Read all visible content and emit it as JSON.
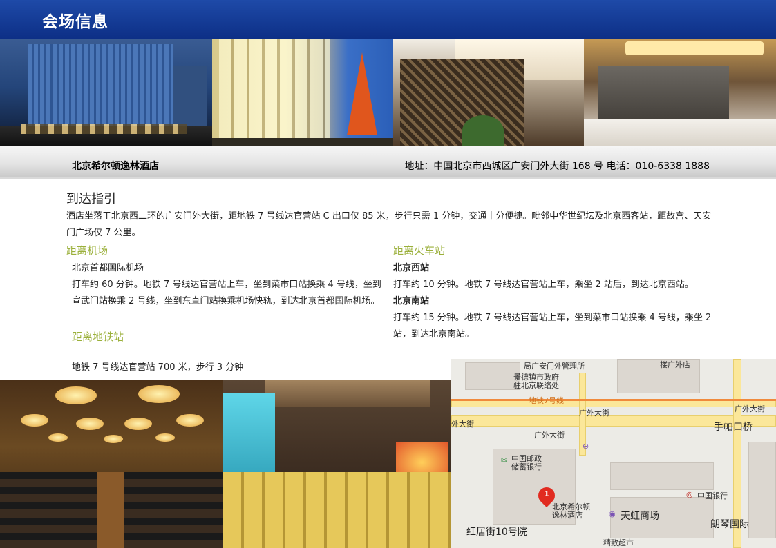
{
  "header": {
    "title": "会场信息"
  },
  "hotel": {
    "name": "北京希尔顿逸林酒店",
    "address_line": "地址：中国北京市西城区广安门外大街 168 号   电话：010-6338 1888"
  },
  "directions": {
    "title": "到达指引",
    "intro": "酒店坐落于北京西二环的广安门外大街，距地铁 7 号线达官营站 C 出口仅 85 米，步行只需 1 分钟，交通十分便捷。毗邻中华世纪坛及北京西客站，距故宫、天安门广场仅 7 公里。",
    "airport": {
      "heading": "距离机场",
      "name": "北京首都国际机场",
      "detail": "打车约 60 分钟。地铁 7 号线达官营站上车，坐到菜市口站换乘 4 号线，坐到宣武门站换乘 2 号线，坐到东直门站换乘机场快轨，到达北京首都国际机场。"
    },
    "subway": {
      "heading": "距离地铁站",
      "detail": "地铁 7 号线达官营站 700 米，步行 3 分钟"
    },
    "train": {
      "heading": "距离火车站",
      "west_name": "北京西站",
      "west_detail": "打车约 10 分钟。地铁 7 号线达官营站上车，乘坐 2 站后，到达北京西站。",
      "south_name": "北京南站",
      "south_detail": "打车约 15 分钟。地铁 7 号线达官营站上车，坐到菜市口站换乘 4 号线，乘坐 2 站，到达北京南站。"
    }
  },
  "map": {
    "labels": {
      "guanli": "局广安门外管理所",
      "louguang": "楼广外店",
      "jingde": "景德镇市政府",
      "zhubei": "驻北京联络处",
      "metro": "地铁7号线",
      "guangwai_top": "广外大街",
      "guangwai_right": "广外大街",
      "waidajie": "外大街",
      "shoupakou": "手帕口桥",
      "guangwai_mid": "广外大街",
      "youzheng": "中国邮政",
      "chuxu": "储蓄银行",
      "bank": "中国银行",
      "hotel1": "北京希尔顿",
      "hotel2": "逸林酒店",
      "tianhong": "天虹商场",
      "langqin": "朗琴国际",
      "hongju": "红居街10号院",
      "jingzhi": "精致超市"
    },
    "pin_number": "1",
    "colors": {
      "road": "#fbe79a",
      "metro": "#f08a3c",
      "pin": "#e12b20"
    }
  }
}
